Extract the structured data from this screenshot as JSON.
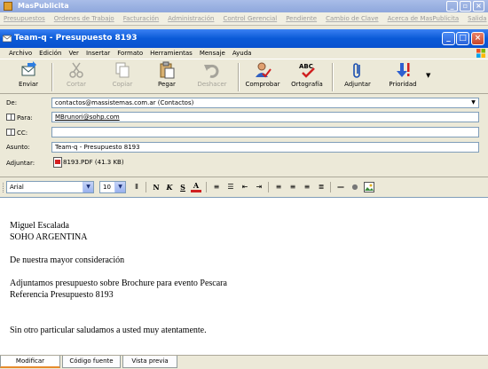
{
  "outer_window": {
    "title": "MasPublicita",
    "menu": [
      "Presupuestos",
      "Ordenes de Trabajo",
      "Facturación",
      "Administración",
      "Control Gerencial",
      "Pendiente",
      "Cambio de Clave",
      "Acerca de MasPublicita",
      "Salida"
    ]
  },
  "window": {
    "title": "Team-q - Presupuesto 8193"
  },
  "menubar": [
    "Archivo",
    "Edición",
    "Ver",
    "Insertar",
    "Formato",
    "Herramientas",
    "Mensaje",
    "Ayuda"
  ],
  "toolbar": {
    "send": "Enviar",
    "cut": "Cortar",
    "copy": "Copiar",
    "paste": "Pegar",
    "undo": "Deshacer",
    "check": "Comprobar",
    "spelling": "Ortografía",
    "attach": "Adjuntar",
    "priority": "Prioridad"
  },
  "header": {
    "from_label": "De:",
    "from_value": "contactos@massistemas.com.ar    (Contactos)",
    "to_label": "Para:",
    "to_value": "MBrunori@sohp.com",
    "cc_label": "CC:",
    "cc_value": "",
    "subject_label": "Asunto:",
    "subject_value": "Team-q - Presupuesto 8193",
    "attach_label": "Adjuntar:",
    "attach_value": "8193.PDF (41.3 KB)"
  },
  "format": {
    "font": "Arial",
    "size": "10"
  },
  "body": {
    "line1": "Miguel Escalada",
    "line2": "SOHO ARGENTINA",
    "line3": "De nuestra mayor consideración",
    "line4": "Adjuntamos presupuesto sobre Brochure para evento Pescara",
    "line5": "Referencia Presupuesto 8193",
    "line6": "Sin otro particular saludamos a usted muy atentamente."
  },
  "tabs": [
    "Modificar",
    "Código fuente",
    "Vista previa"
  ]
}
